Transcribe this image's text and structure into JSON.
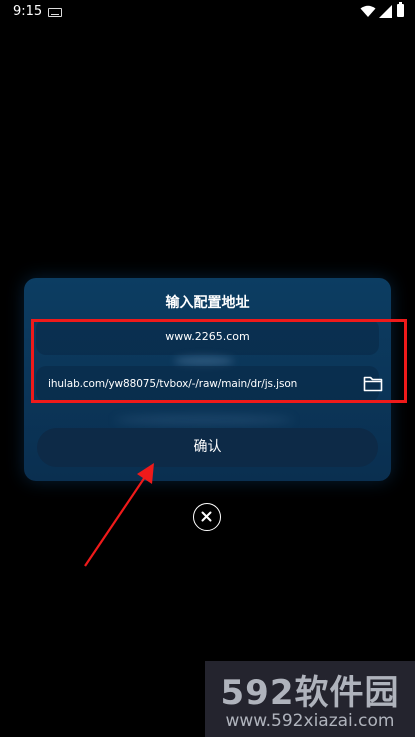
{
  "status_bar": {
    "time": "9:15",
    "icons": [
      "keyboard-icon",
      "wifi-icon",
      "signal-icon",
      "battery-icon"
    ]
  },
  "dialog": {
    "title": "输入配置地址",
    "url_field_value": "www.2265.com",
    "path_field_value": "ihulab.com/yw88075/tvbox/-/raw/main/dr/js.json",
    "folder_icon": "folder-icon",
    "confirm_label": "确认",
    "close_icon": "close-icon"
  },
  "annotation": {
    "highlight_color": "#ef1a1a",
    "arrow_color": "#ef1a1a"
  },
  "watermark": {
    "logo_text": "592软件园",
    "url_text": "www.592xiazai.com"
  },
  "colors": {
    "background": "#000000",
    "dialog_bg": "#0b3558",
    "button_bg": "#0d2a47"
  }
}
